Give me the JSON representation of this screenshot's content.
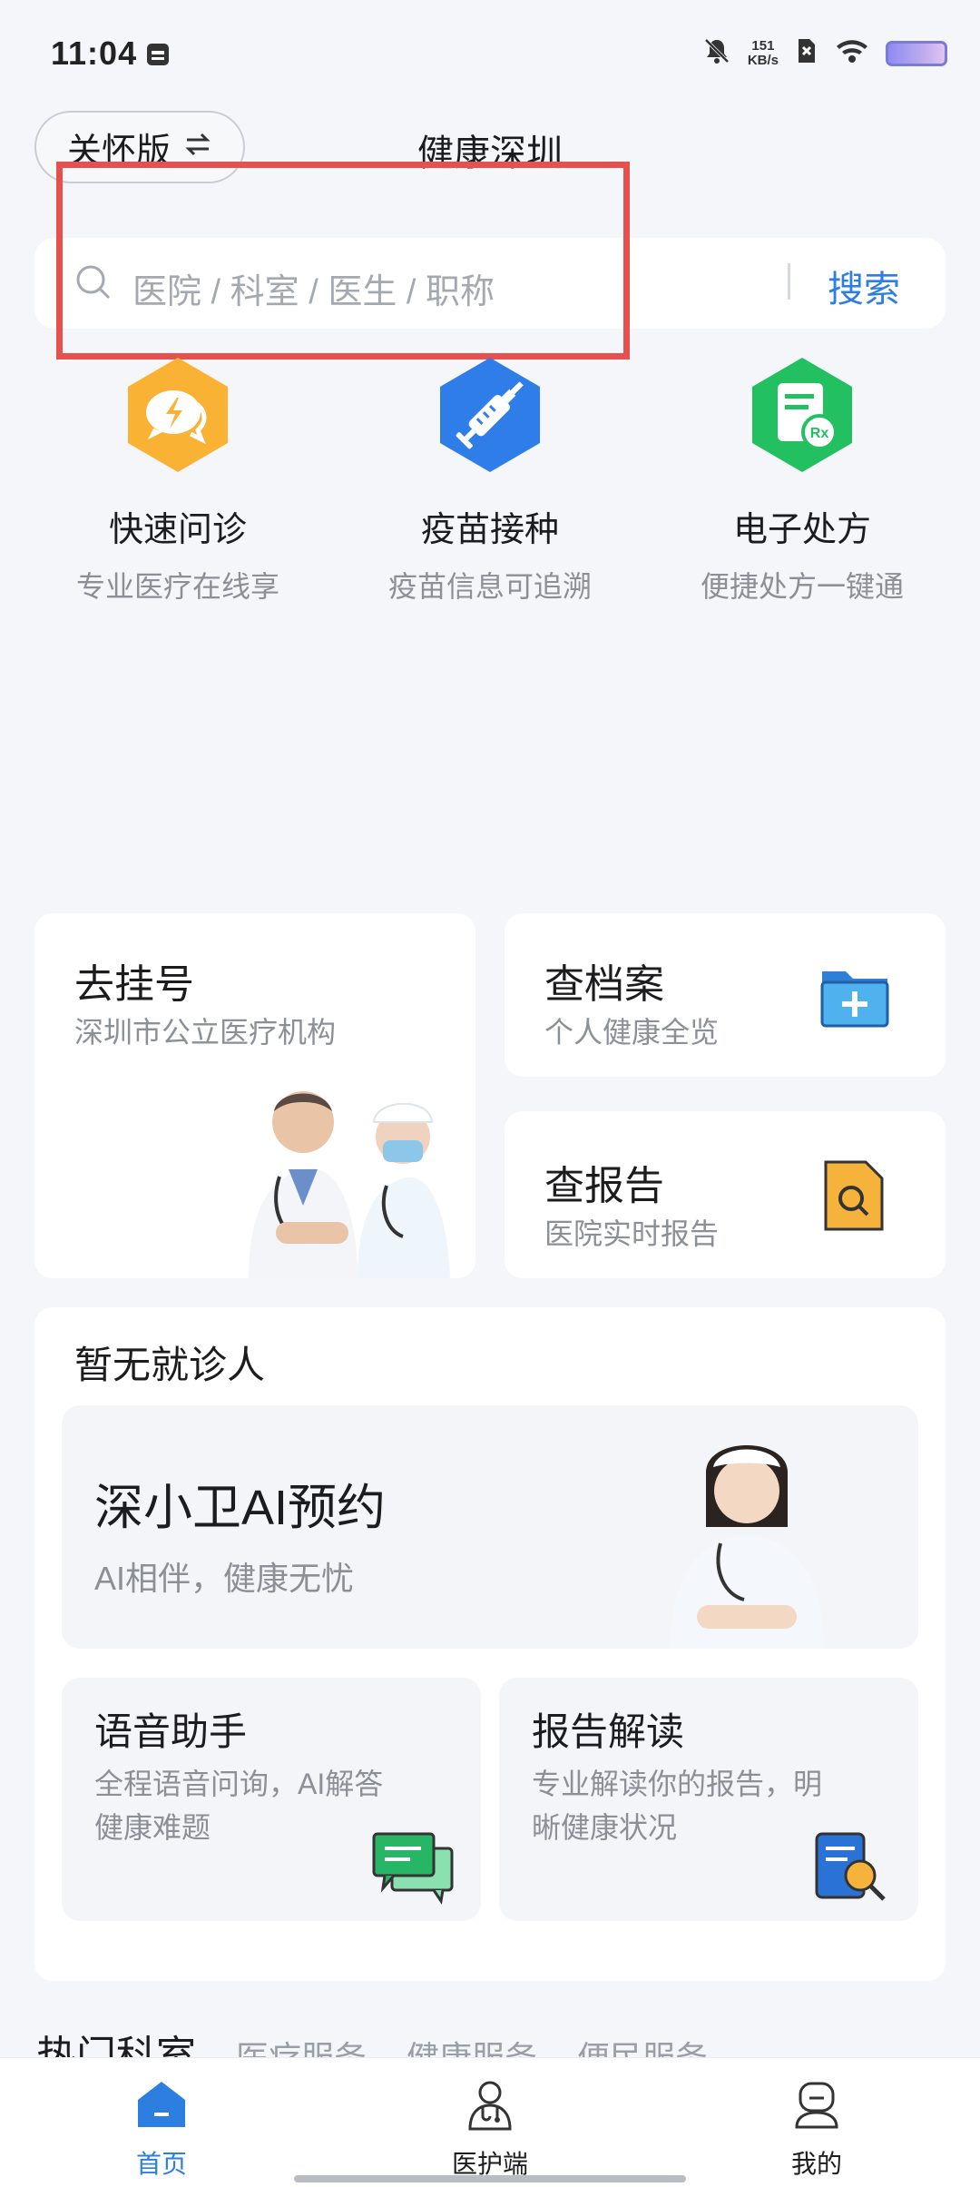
{
  "status_bar": {
    "time": "11:04",
    "net_speed_value": "151",
    "net_speed_unit": "KB/s"
  },
  "header": {
    "care_mode_label": "关怀版",
    "care_mode_icon": "swap-arrows-icon",
    "title": "健康深圳"
  },
  "search": {
    "placeholder": "医院 / 科室 / 医生 / 职称",
    "button_label": "搜索"
  },
  "quick_actions": [
    {
      "title": "快速问诊",
      "subtitle": "专业医疗在线享",
      "icon": "lightning-chat-icon",
      "color": "#f9b233"
    },
    {
      "title": "疫苗接种",
      "subtitle": "疫苗信息可追溯",
      "icon": "syringe-icon",
      "color": "#2f7de8"
    },
    {
      "title": "电子处方",
      "subtitle": "便捷处方一键通",
      "icon": "prescription-icon",
      "color": "#22c060"
    }
  ],
  "services": {
    "register": {
      "title": "去挂号",
      "subtitle": "深圳市公立医疗机构"
    },
    "records": {
      "title": "查档案",
      "subtitle": "个人健康全览"
    },
    "reports": {
      "title": "查报告",
      "subtitle": "医院实时报告"
    }
  },
  "patient_section": {
    "title": "暂无就诊人",
    "ai_booking": {
      "title": "深小卫AI预约",
      "subtitle": "AI相伴，健康无忧"
    },
    "voice_assistant": {
      "title": "语音助手",
      "subtitle_line1": "全程语音问询，AI解答",
      "subtitle_line2": "健康难题"
    },
    "report_reading": {
      "title": "报告解读",
      "subtitle_line1": "专业解读你的报告，明",
      "subtitle_line2": "晰健康状况"
    }
  },
  "tabs": [
    "热门科室",
    "医疗服务",
    "健康服务",
    "便民服务"
  ],
  "bottom_nav": [
    {
      "label": "首页",
      "active": true
    },
    {
      "label": "医护端",
      "active": false
    },
    {
      "label": "我的",
      "active": false
    }
  ],
  "colors": {
    "accent": "#2c7ee0",
    "highlight_box": "#e4514f"
  }
}
